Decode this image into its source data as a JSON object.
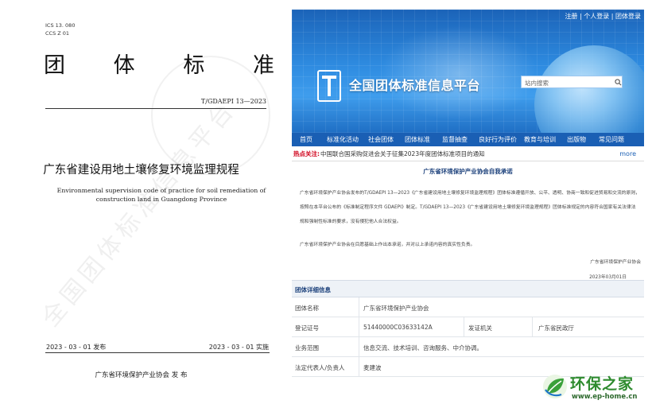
{
  "document": {
    "ics": "ICS  13. 080",
    "ccs": "CCS  Z   01",
    "category_chars": [
      "团",
      "体",
      "标",
      "准"
    ],
    "standard_number": "T/GDAEPI 13—2023",
    "title_cn": "广东省建设用地土壤修复环境监理规程",
    "title_en": "Environmental supervision code of practice for soil remediation of construction land in Guangdong Province",
    "publish_date": "2023 - 03 - 01 发布",
    "implement_date": "2023 - 03 - 01 实施",
    "issuer": "广东省环境保护产业协会        发 布",
    "watermark": "全国团体标准信息平台"
  },
  "website": {
    "top_links": [
      "注册",
      "个人登录",
      "团体登录"
    ],
    "site_name": "全国团体标准信息平台",
    "search_placeholder": "站内搜索",
    "nav": [
      "首页",
      "标准化活动",
      "社会团体",
      "团体标准",
      "监督抽查",
      "良好行为评价",
      "教育与培训",
      "出版物",
      "常见问题"
    ],
    "notice_label": "热点关注:",
    "notice_text": "中国联合国采购促进会关于征集2023年度团体标准项目的通知",
    "more": "more",
    "pledge_title": "广东省环境保护产业协会自我承诺",
    "pledge_p1": "广东省环境保护产业协会发布的T/GDAEPI 13—2023《广东省建设用地土壤修复环境监理规程》团体标准遵循开放、公平、透明、协商一致和促进贸易和交流的原则，按照在本平台公布的《标准制定程序文件 GDAEPI》制定。T/GDAEPI 13—2023《广东省建设用地土壤修复环境监理规程》团体标准规定的内容符合国家有关法律法规和强制性标准的要求，没有侵犯他人合法权益。",
    "pledge_p2": "广东省环境保护产业协会在目愿基础上作出本承诺，并对以上承诺内容的真实性负责。",
    "pledge_signature": "广东省环境保护产业协会",
    "pledge_date": "2023年03月01日",
    "info_header": "团体详细信息",
    "info_rows": [
      {
        "label": "团体名称",
        "value": "广东省环境保护产业协会",
        "label2": "",
        "value2": ""
      },
      {
        "label": "登记证号",
        "value": "51440000C03633142A",
        "label2": "发证机关",
        "value2": "广东省民政厅"
      },
      {
        "label": "业务范围",
        "value": "信息交流、技术培训、咨询服务、中介协调。",
        "label2": "",
        "value2": ""
      },
      {
        "label": "法定代表人/负责人",
        "value": "麦建波",
        "label2": "",
        "value2": ""
      }
    ]
  },
  "brand": {
    "name": "环保之家",
    "url": "www.ep-home.cn"
  }
}
